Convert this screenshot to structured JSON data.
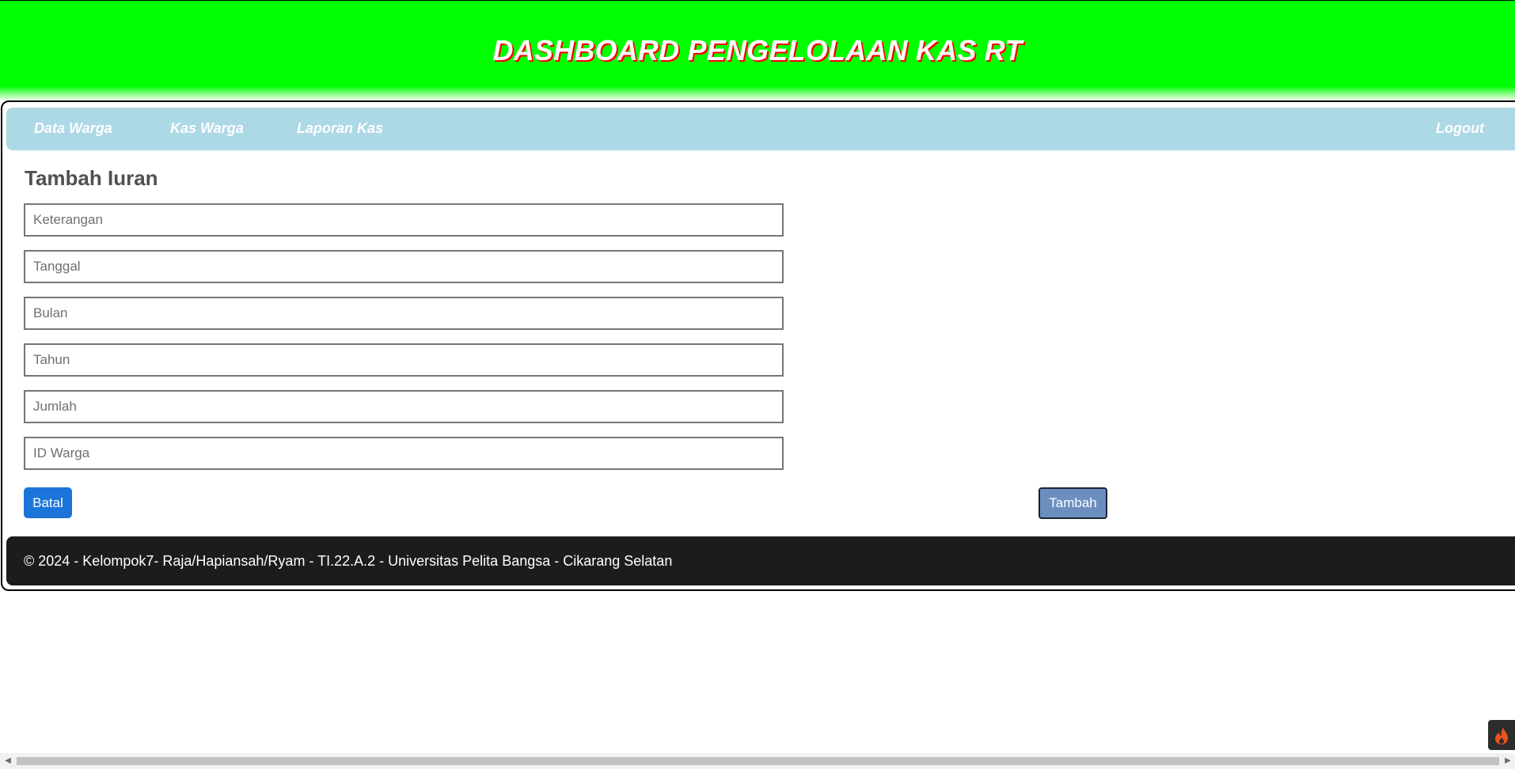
{
  "header": {
    "title": "DASHBOARD PENGELOLAAN KAS RT"
  },
  "nav": {
    "items": [
      {
        "label": "Data Warga"
      },
      {
        "label": "Kas Warga"
      },
      {
        "label": "Laporan Kas"
      }
    ],
    "logout_label": "Logout"
  },
  "form": {
    "title": "Tambah Iuran",
    "fields": [
      {
        "placeholder": "Keterangan",
        "value": ""
      },
      {
        "placeholder": "Tanggal",
        "value": ""
      },
      {
        "placeholder": "Bulan",
        "value": ""
      },
      {
        "placeholder": "Tahun",
        "value": ""
      },
      {
        "placeholder": "Jumlah",
        "value": ""
      },
      {
        "placeholder": "ID Warga",
        "value": ""
      }
    ],
    "cancel_label": "Batal",
    "submit_label": "Tambah"
  },
  "footer": {
    "text": "© 2024 - Kelompok7- Raja/Hapiansah/Ryam - TI.22.A.2 - Universitas Pelita Bangsa - Cikarang Selatan"
  },
  "colors": {
    "header_bg": "#00ff00",
    "title_shadow": "#ff0000",
    "navbar_bg": "#add8e6",
    "batal_bg": "#1b75d8",
    "tambah_bg": "#6c8ebf",
    "footer_bg": "#1c1c1c"
  },
  "icons": {
    "scroll_left": "chevron-left-icon",
    "scroll_right": "chevron-right-icon",
    "widget": "flame-icon"
  }
}
